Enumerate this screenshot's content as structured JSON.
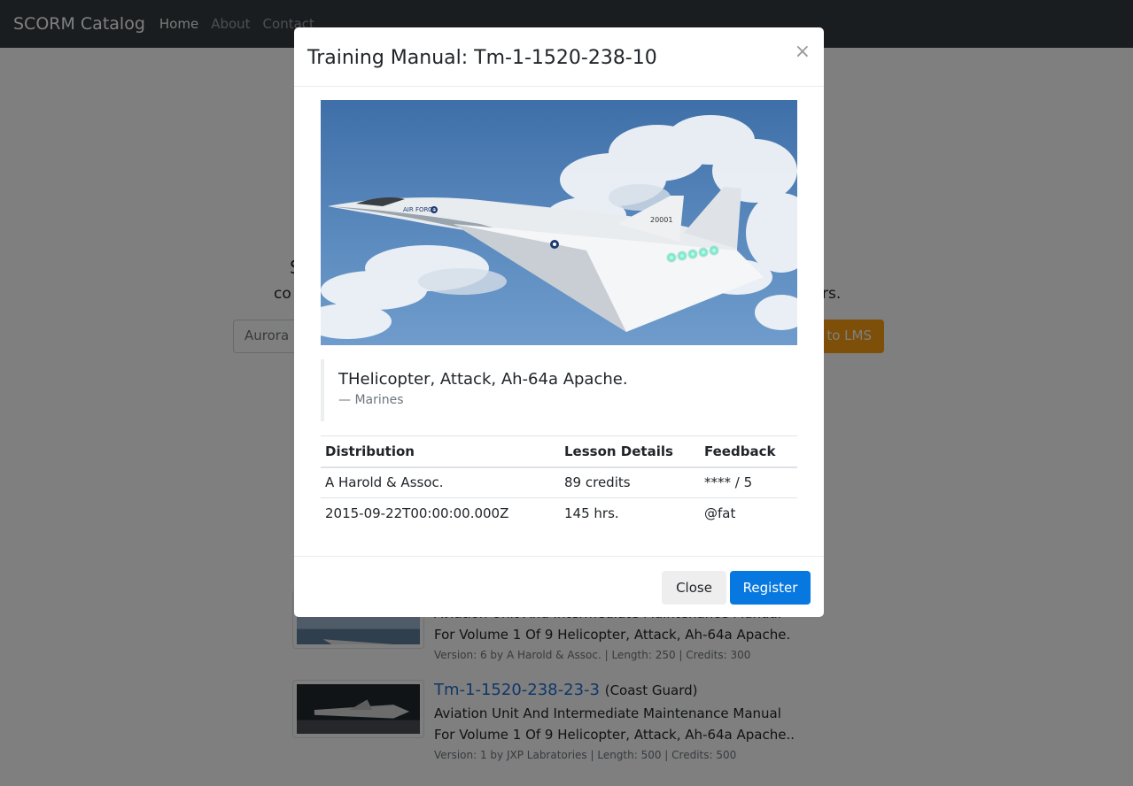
{
  "navbar": {
    "brand": "SCORM Catalog",
    "links": [
      "Home",
      "About",
      "Contact"
    ]
  },
  "background": {
    "hero_heading_left": "S",
    "hero_heading_right": "l",
    "hero_text_left": "co",
    "hero_text_right": "rs.",
    "search_value": "Aurora F",
    "lms_button_label": "to LMS",
    "courses": [
      {
        "title_link": "",
        "title_branch": "",
        "description": "Aviation Unit And Intermediate Maintenance Manual For Volume 1 Of 9 Helicopter, Attack, Ah-64a Apache.",
        "meta": "Version: 6 by A Harold & Assoc. | Length: 250 | Credits: 300"
      },
      {
        "title_link": "Tm-1-1520-238-23-3",
        "title_branch": "(Coast Guard)",
        "description": "Aviation Unit And Intermediate Maintenance Manual For Volume 1 Of 9 Helicopter, Attack, Ah-64a Apache..",
        "meta": "Version: 1 by JXP Labratories | Length: 500 | Credits: 500"
      }
    ]
  },
  "modal": {
    "title": "Training Manual: Tm-1-1520-238-10",
    "close_symbol": "×",
    "image_text": {
      "fuselage": "AIR FORCE",
      "tail_number": "20001"
    },
    "quote": {
      "text": "THelicopter, Attack, Ah-64a Apache.",
      "footer": "— Marines"
    },
    "table": {
      "headers": [
        "Distribution",
        "Lesson Details",
        "Feedback"
      ],
      "rows": [
        [
          "A Harold & Assoc.",
          "89 credits",
          "**** / 5"
        ],
        [
          "2015-09-22T00:00:00.000Z",
          "145 hrs.",
          "@fat"
        ]
      ]
    },
    "buttons": {
      "close": "Close",
      "register": "Register"
    }
  },
  "colors": {
    "navbar_bg": "#343a40",
    "primary": "#0778e0",
    "warning": "#fd9f12",
    "link": "#1f6fd0"
  }
}
